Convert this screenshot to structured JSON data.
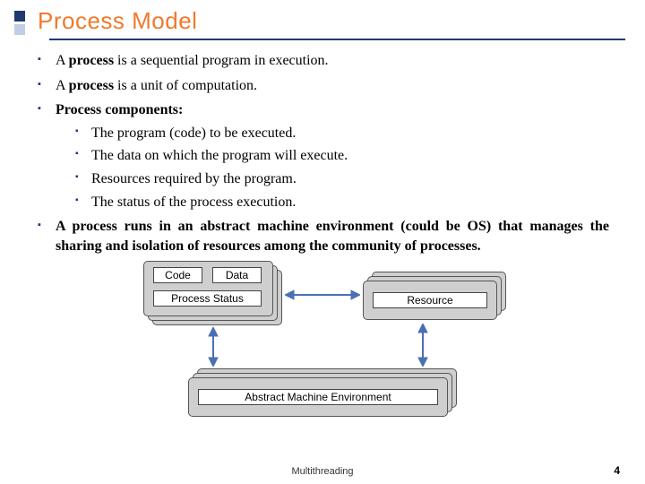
{
  "title": "Process Model",
  "bullets": {
    "b1_pre": "A ",
    "b1_strong": "process",
    "b1_post": " is a sequential program in execution.",
    "b2_pre": "A ",
    "b2_strong": "process",
    "b2_post": " is a unit of computation.",
    "b3": "Process components:",
    "sub": {
      "s1": "The program (code) to be executed.",
      "s2": "The data on which the program will execute.",
      "s3": "Resources required by the program.",
      "s4": "The status of the process execution."
    },
    "b4": "A process runs in an abstract machine environment (could be OS) that manages the sharing and isolation of resources among the community of processes."
  },
  "diagram": {
    "code": "Code",
    "data": "Data",
    "status": "Process Status",
    "resource": "Resource",
    "ame": "Abstract Machine Environment"
  },
  "footer": "Multithreading",
  "page": "4"
}
